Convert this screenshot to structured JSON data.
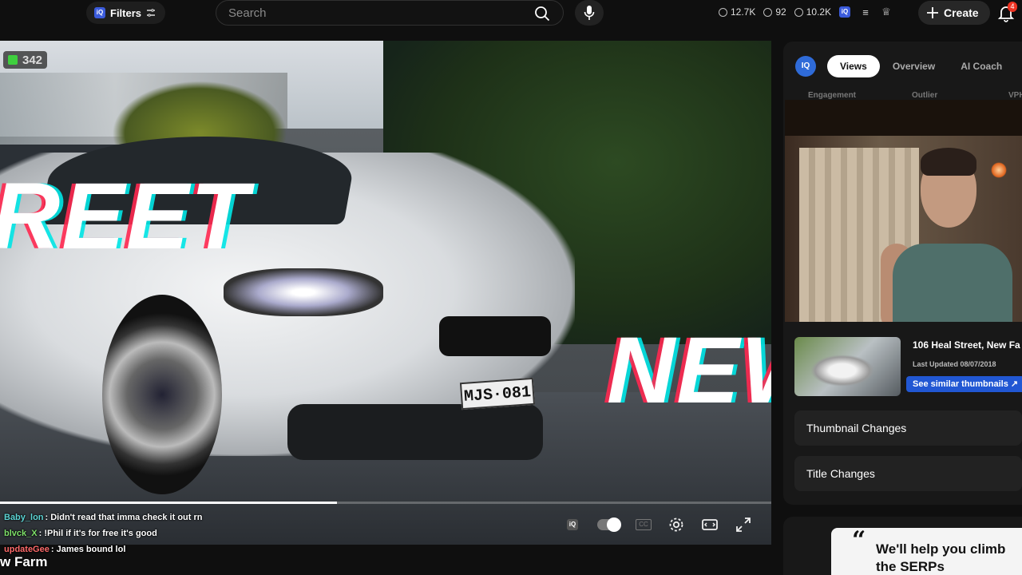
{
  "topbar": {
    "filters_label": "Filters",
    "search_placeholder": "Search",
    "stats": [
      "12.7K",
      "92",
      "10.2K"
    ],
    "create_label": "Create",
    "notification_count": "4",
    "icons": [
      "iq-logo-icon",
      "filter-icon",
      "search-icon",
      "mic-icon",
      "clock-icon",
      "eye-icon",
      "list-icon",
      "trophy-icon",
      "plus-icon",
      "bell-icon"
    ]
  },
  "player": {
    "viewer_count": "342",
    "overlay_left": "REET",
    "overlay_right": "NEW",
    "plate": "MJS·081",
    "progress": 0.437,
    "controls": [
      "iq-icon",
      "autoplay-toggle",
      "cc-icon",
      "settings-icon",
      "theater-icon",
      "fullscreen-icon"
    ],
    "cc_label": "CC"
  },
  "chat": [
    {
      "user": "Baby_lon",
      "color": "#5dd4d4",
      "message": ": Didn't read that imma check it out rn"
    },
    {
      "user": "blvck_X",
      "color": "#7ee06a",
      "message": ": !Phil if it's for free it's good"
    },
    {
      "user": "updateGee",
      "color": "#ff6a6a",
      "message": ": James bound lol"
    }
  ],
  "stream_title": "w Farm",
  "panel": {
    "logo": "IQ",
    "tabs": [
      "Views",
      "Overview",
      "AI Coach"
    ],
    "active_tab": "Views",
    "subtabs": [
      "Engagement",
      "Outlier",
      "VPH"
    ],
    "video": {
      "title": "106 Heal Street, New Fa",
      "updated": "Last Updated 08/07/2018",
      "similar_label": "See similar thumbnails ↗"
    },
    "sections": [
      "Thumbnail Changes",
      "Title Changes"
    ]
  },
  "ad": {
    "quote": "“",
    "text": "We'll help you climb the SERPs"
  },
  "colors": {
    "accent": "#2157d3",
    "background": "#0f0f0f",
    "panel": "#181818"
  }
}
